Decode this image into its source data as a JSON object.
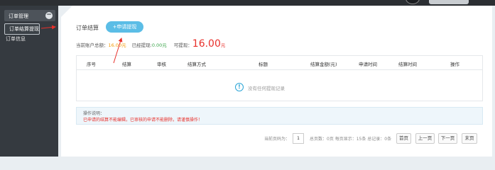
{
  "sidebar": {
    "group_label": "订单管理",
    "toggle_symbol": "−",
    "items": [
      {
        "label": "订单结算提现"
      },
      {
        "label": "订单信息"
      }
    ]
  },
  "header": {
    "page_title": "订单结算",
    "apply_button": "+申请提现"
  },
  "summary": {
    "total_label": "当前账户总额：",
    "total_value": "16.00",
    "total_unit": "元",
    "withdrawn_label": "已经提现:",
    "withdrawn_value": "0.00",
    "withdrawn_unit": "元",
    "available_label": "可提现：",
    "available_value": "16.00",
    "available_unit": "元"
  },
  "table": {
    "columns": [
      "序号",
      "结算",
      "审核",
      "结算方式",
      "标题",
      "结算金额(元)",
      "申请时间",
      "结算时间",
      "操作"
    ],
    "empty_text": "没有任何提现记录"
  },
  "note": {
    "title": "操作说明：",
    "text": "已申请的结算不能编辑，已审核的申请不能删除，请谨慎操作！"
  },
  "pager": {
    "current_label": "当前页码为：",
    "current_page": "1",
    "stats": "总页数：0页 每页显示：15条 总记录：0条",
    "first": "首页",
    "prev": "上一页",
    "next": "下一页",
    "last": "末页"
  },
  "colors": {
    "sidebar_bg": "#353a40",
    "accent_blue": "#5bbde6",
    "warning_red": "#e8302b",
    "amount_orange": "#f39800",
    "amount_green": "#3aa54a"
  }
}
